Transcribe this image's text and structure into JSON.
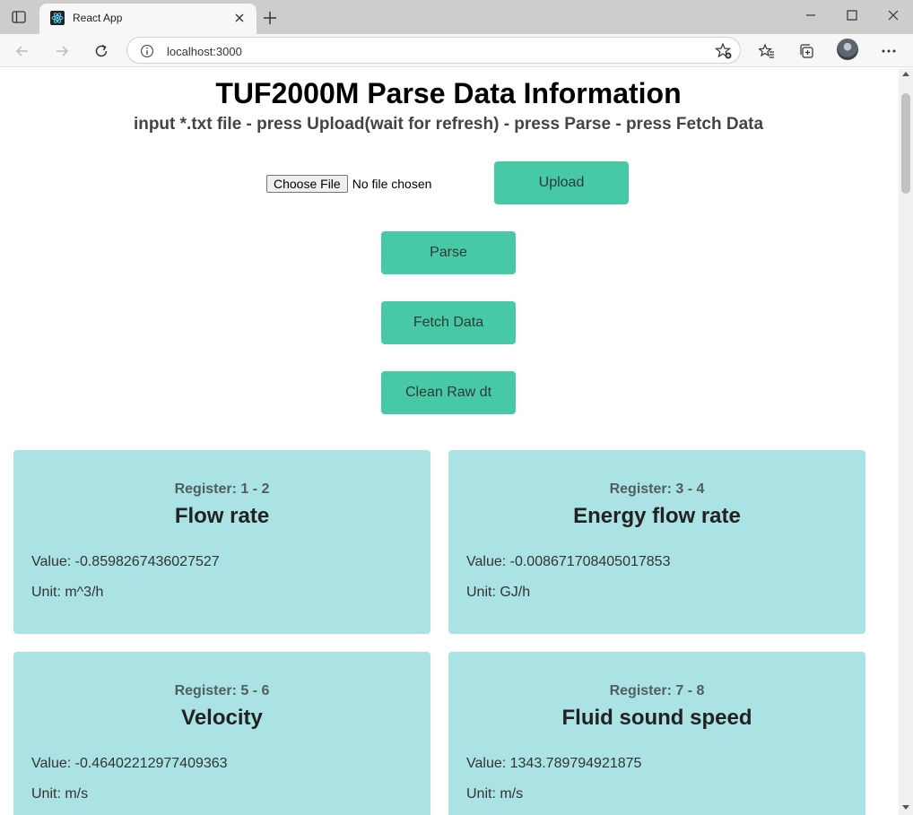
{
  "browser": {
    "tab_title": "React App",
    "url": "localhost:3000"
  },
  "icons": {
    "favicon": "react-icon",
    "tab_actions": "tab-actions-icon",
    "close": "close-icon",
    "new_tab": "plus-icon",
    "back": "back-arrow-icon",
    "forward": "forward-arrow-icon",
    "refresh": "refresh-icon",
    "info": "info-icon",
    "favorite_add": "star-plus-icon",
    "favorites": "favorites-icon",
    "collections": "collections-icon",
    "profile": "avatar",
    "menu": "more-icon"
  },
  "page": {
    "title": "TUF2000M Parse Data Information",
    "subtitle": "input *.txt file - press Upload(wait for refresh) - press Parse - press Fetch Data",
    "file_input": {
      "button_label": "Choose File",
      "status": "No file chosen"
    },
    "buttons": {
      "upload": "Upload",
      "parse": "Parse",
      "fetch": "Fetch Data",
      "clean": "Clean Raw dt"
    },
    "cards": [
      {
        "register": "Register: 1 - 2",
        "name": "Flow rate",
        "value": "Value: -0.8598267436027527",
        "unit": "Unit: m^3/h"
      },
      {
        "register": "Register: 3 - 4",
        "name": "Energy flow rate",
        "value": "Value: -0.008671708405017853",
        "unit": "Unit: GJ/h"
      },
      {
        "register": "Register: 5 - 6",
        "name": "Velocity",
        "value": "Value: -0.46402212977409363",
        "unit": "Unit: m/s"
      },
      {
        "register": "Register: 7 - 8",
        "name": "Fluid sound speed",
        "value": "Value: 1343.789794921875",
        "unit": "Unit: m/s"
      }
    ]
  },
  "colors": {
    "button_bg": "#48c9a5",
    "card_bg": "#abe3e5",
    "chrome_bg": "#cdcdcd"
  }
}
